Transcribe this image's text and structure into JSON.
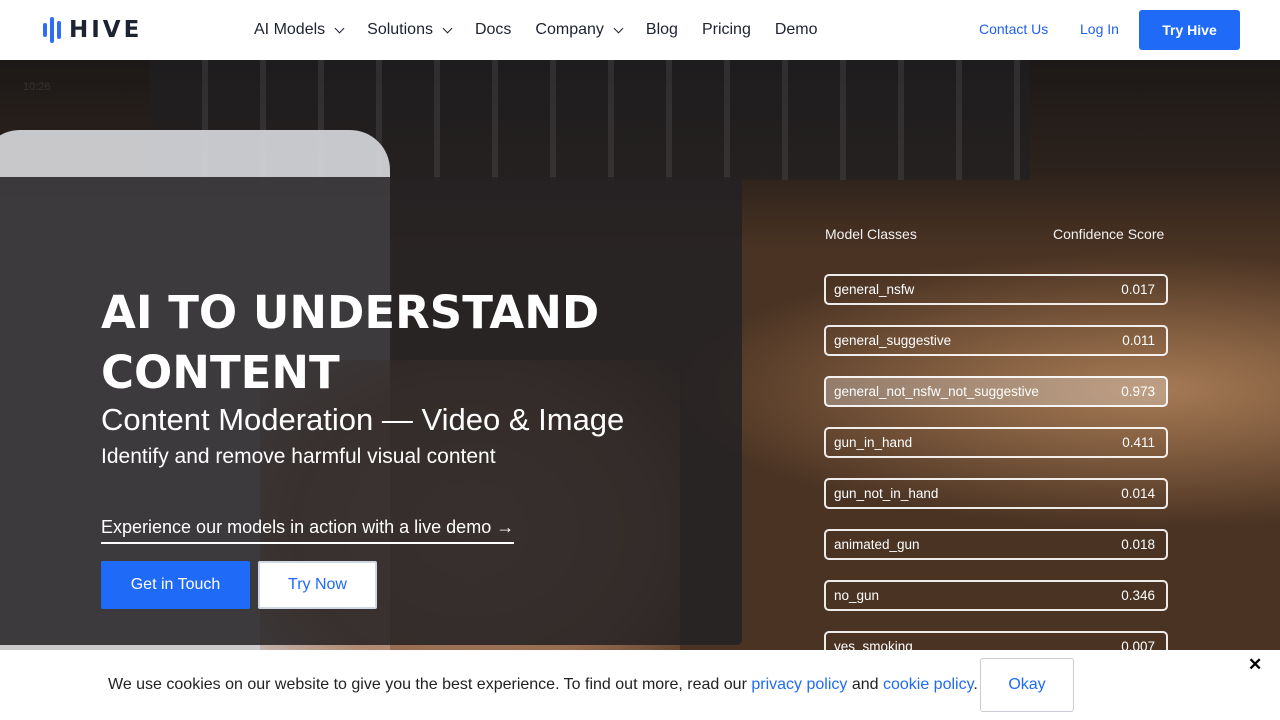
{
  "header": {
    "logo_text": "HIVE",
    "nav": [
      {
        "label": "AI Models",
        "dropdown": true
      },
      {
        "label": "Solutions",
        "dropdown": true
      },
      {
        "label": "Docs",
        "dropdown": false
      },
      {
        "label": "Company",
        "dropdown": true
      },
      {
        "label": "Blog",
        "dropdown": false
      },
      {
        "label": "Pricing",
        "dropdown": false
      },
      {
        "label": "Demo",
        "dropdown": false
      }
    ],
    "contact_label": "Contact Us",
    "login_label": "Log In",
    "try_label": "Try Hive"
  },
  "hero": {
    "phone_time": "10:26",
    "title": "AI TO UNDERSTAND CONTENT",
    "subtitle": "Content Moderation — Video & Image",
    "tagline": "Identify and remove harmful visual content",
    "demo_link": "Experience our models in action with a live demo →",
    "primary_button": "Get in Touch",
    "secondary_button": "Try Now"
  },
  "model_panel": {
    "col_classes": "Model Classes",
    "col_score": "Confidence Score",
    "rows": [
      {
        "name": "general_nsfw",
        "score": "0.017"
      },
      {
        "name": "general_suggestive",
        "score": "0.011"
      },
      {
        "name": "general_not_nsfw_not_suggestive",
        "score": "0.973"
      },
      {
        "name": "gun_in_hand",
        "score": "0.411"
      },
      {
        "name": "gun_not_in_hand",
        "score": "0.014"
      },
      {
        "name": "animated_gun",
        "score": "0.018"
      },
      {
        "name": "no_gun",
        "score": "0.346"
      },
      {
        "name": "yes_smoking",
        "score": "0.007"
      }
    ]
  },
  "cookie": {
    "text_before": "We use cookies on our website to give you the best experience. To find out more, read our ",
    "privacy_link": "privacy policy",
    "and_text": " and ",
    "cookie_link": "cookie policy",
    "period": ".",
    "okay_label": "Okay",
    "close_symbol": "✕"
  },
  "colors": {
    "accent": "#1f6bf7",
    "logo_blue": "#2f6df5"
  }
}
